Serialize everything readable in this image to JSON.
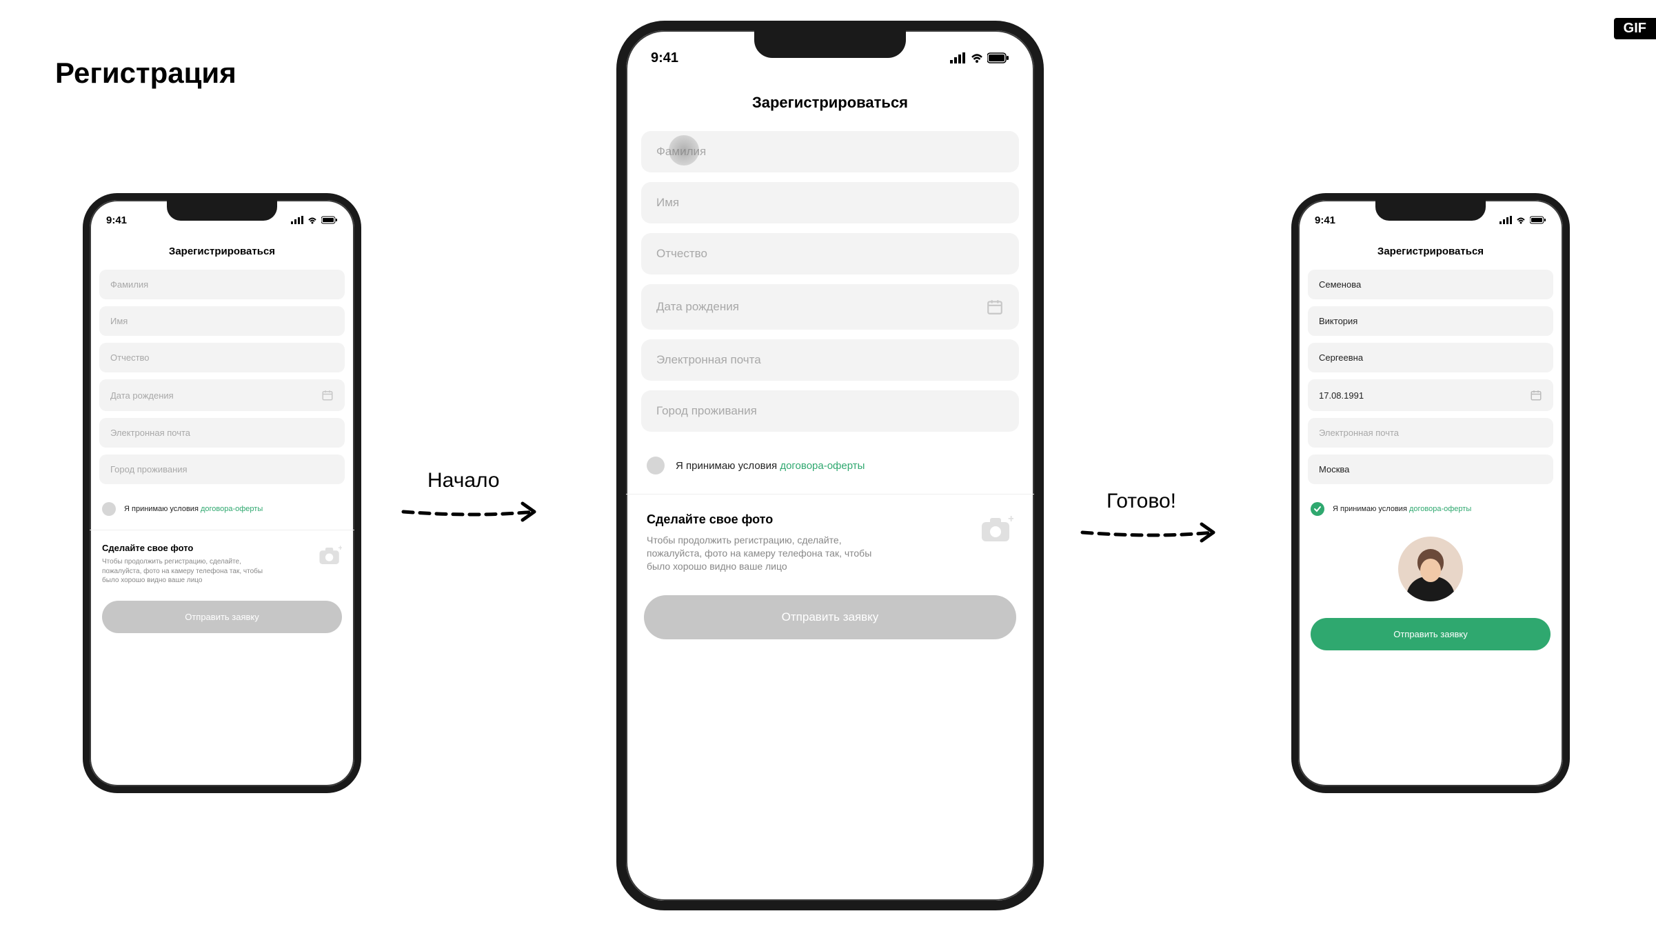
{
  "page": {
    "title": "Регистрация",
    "gif_badge": "GIF"
  },
  "arrows": {
    "start": "Начало",
    "done": "Готово!"
  },
  "status": {
    "time": "9:41"
  },
  "screens": {
    "title": "Зарегистрироваться",
    "fields": {
      "surname_ph": "Фамилия",
      "name_ph": "Имя",
      "patronymic_ph": "Отчество",
      "dob_ph": "Дата рождения",
      "email_ph": "Электронная почта",
      "city_ph": "Город проживания"
    },
    "consent": {
      "text": "Я принимаю условия ",
      "link": "договора-оферты"
    },
    "photo": {
      "title": "Сделайте свое фото",
      "desc": "Чтобы продолжить регистрацию, сделайте, пожалуйста, фото на камеру телефона так, чтобы было хорошо видно ваше лицо"
    },
    "submit": "Отправить заявку"
  },
  "filled": {
    "surname": "Семенова",
    "name": "Виктория",
    "patronymic": "Сергеевна",
    "dob": "17.08.1991",
    "email": "Электронная почта",
    "city": "Москва"
  }
}
